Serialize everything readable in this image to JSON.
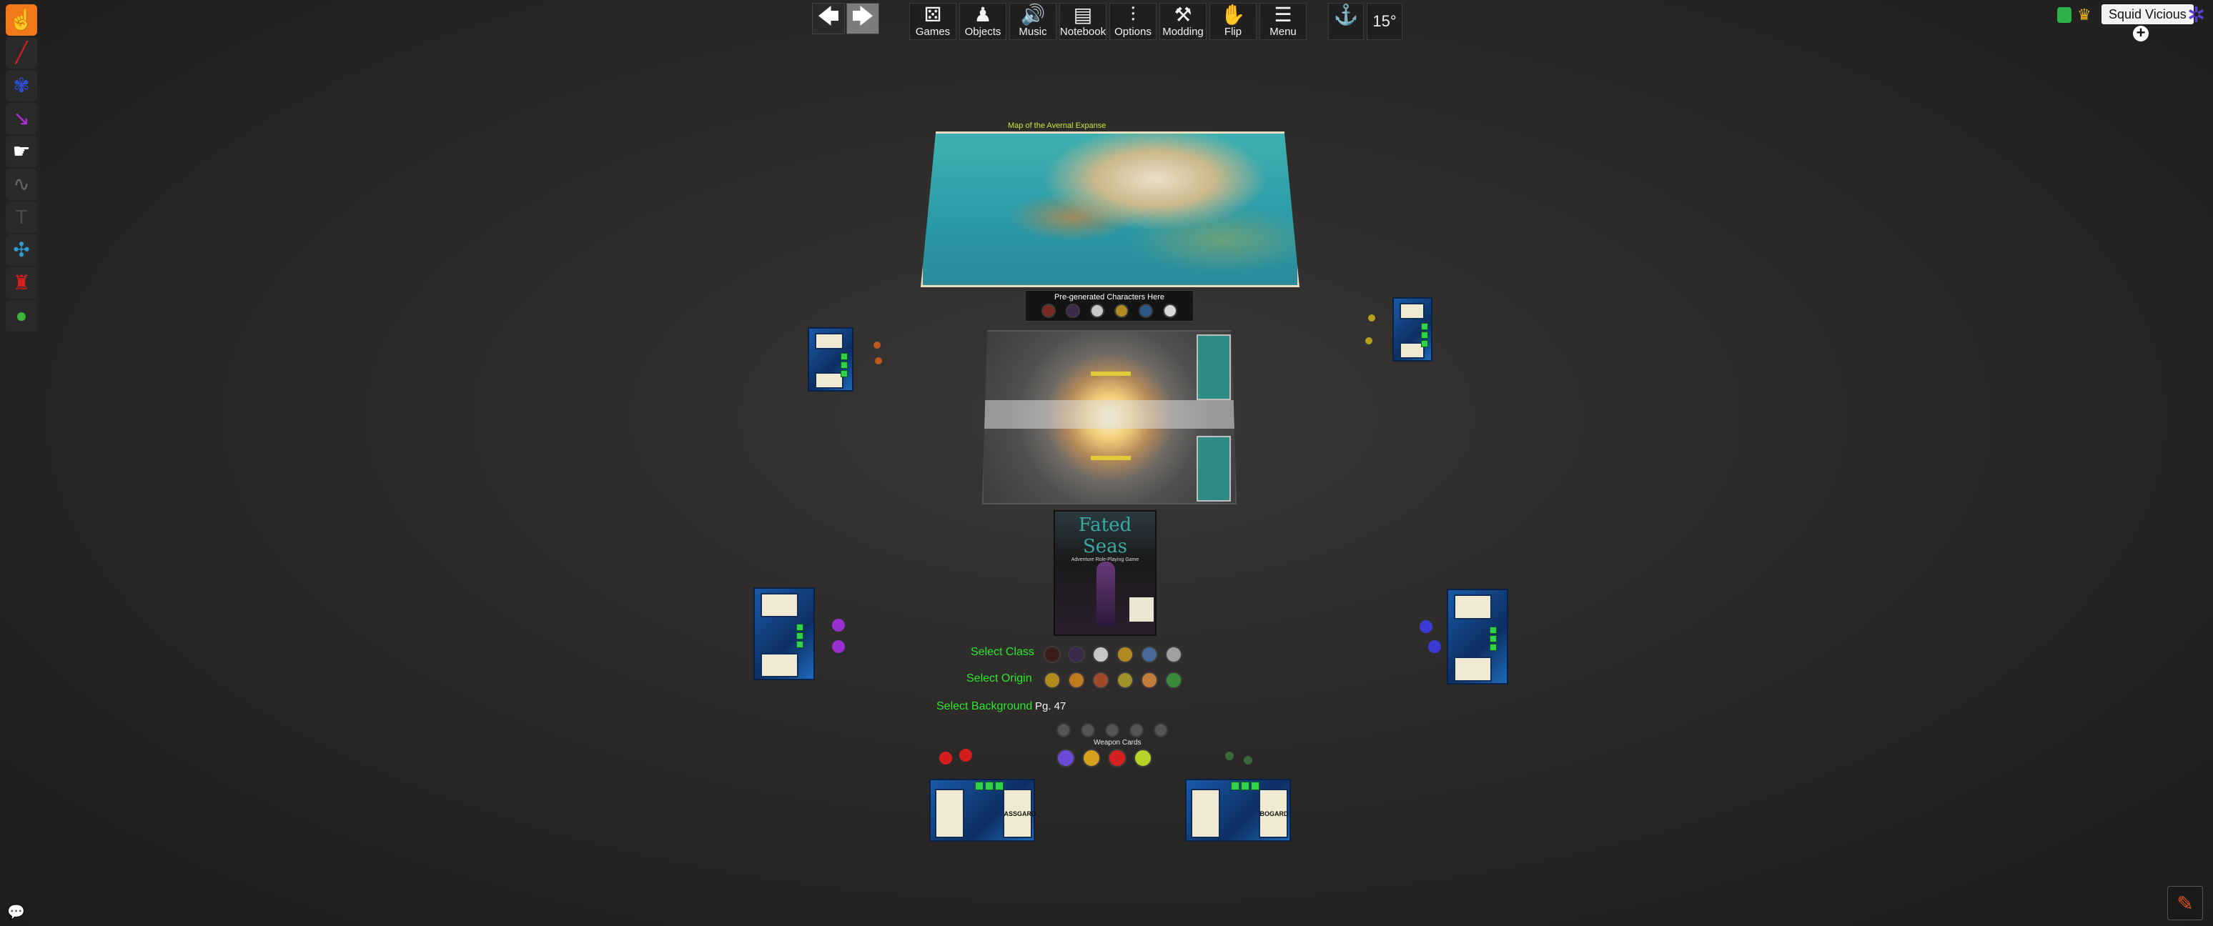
{
  "toolbar": {
    "tools": [
      {
        "name": "grab-tool",
        "icon": "☝",
        "color": "#ffffff",
        "active": true
      },
      {
        "name": "line-tool",
        "icon": "╱",
        "color": "#d42020"
      },
      {
        "name": "flick-tool",
        "icon": "✾",
        "color": "#2c4fd4"
      },
      {
        "name": "ruler-tool",
        "icon": "↘",
        "color": "#b02fd4"
      },
      {
        "name": "gizmo-tool",
        "icon": "☛",
        "color": "#ffffff"
      },
      {
        "name": "snap-tool",
        "icon": "∿",
        "color": "#666666"
      },
      {
        "name": "text-tool",
        "icon": "T",
        "color": "#4a4a4a"
      },
      {
        "name": "zone-tool",
        "icon": "✣",
        "color": "#2c9cd4"
      },
      {
        "name": "hidden-zone-tool",
        "icon": "♜",
        "color": "#d42020"
      },
      {
        "name": "draw-tool",
        "icon": "●",
        "color": "#3cb43c"
      }
    ]
  },
  "topmenu": {
    "back_arrow": "🡄",
    "forward_arrow": "🡆",
    "items": [
      {
        "icon": "⚄",
        "label": "Games"
      },
      {
        "icon": "♟",
        "label": "Objects"
      },
      {
        "icon": "🔊",
        "label": "Music"
      },
      {
        "icon": "▤",
        "label": "Notebook"
      },
      {
        "icon": "⫶",
        "label": "Options"
      },
      {
        "icon": "⚒",
        "label": "Modding"
      },
      {
        "icon": "✋",
        "label": "Flip"
      },
      {
        "icon": "☰",
        "label": "Menu"
      }
    ],
    "rotate_icon": "⚓",
    "rotation": "15°"
  },
  "player": {
    "name": "Squid Vicious",
    "add": "+"
  },
  "table": {
    "map_title": "Map of the Avernal Expanse",
    "pregen_title": "Pre-generated Characters Here",
    "book_title": "Fated Seas",
    "book_subtitle": "Adventure Role-Playing Game",
    "select_class": "Select Class",
    "select_origin": "Select Origin",
    "select_background": "Select Background",
    "background_page": "Pg. 47",
    "weapon_cards": "Weapon Cards",
    "mat_label_left": "ASSGARD",
    "mat_label_right": "BOGARD"
  },
  "colors": {
    "accent": "#f07a1a",
    "select_text": "#2ee62e",
    "background": "#2b2a28"
  },
  "footer": {
    "chat_icon": "💬",
    "notes_icon": "✎"
  }
}
